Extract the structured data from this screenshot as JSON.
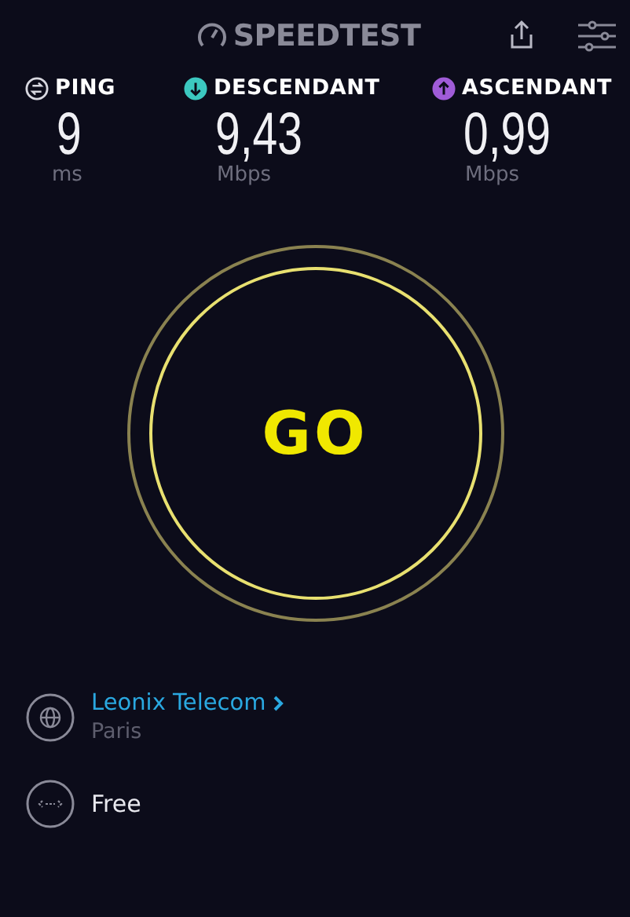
{
  "header": {
    "logo": "SPEEDTEST"
  },
  "metrics": [
    {
      "kind": "ping",
      "label": "PING",
      "value": "9",
      "unit": "ms",
      "color": "#d8d8e0"
    },
    {
      "kind": "download",
      "label": "DESCENDANT",
      "value": "9,43",
      "unit": "Mbps",
      "color": "#3cc8c0"
    },
    {
      "kind": "upload",
      "label": "ASCENDANT",
      "value": "0,99",
      "unit": "Mbps",
      "color": "#a05cd8"
    }
  ],
  "go_button": {
    "label": "GO"
  },
  "server": {
    "provider": "Leonix Telecom",
    "location": "Paris"
  },
  "connection": {
    "name": "Free"
  }
}
